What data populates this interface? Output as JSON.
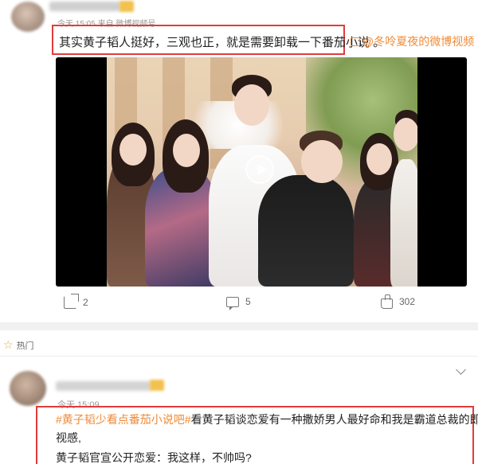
{
  "post": {
    "meta": "今天 15:05  来自 微博视频号",
    "text": "其实黄子韬人挺好，三观也正，就是需要卸载一下番茄小说 。",
    "video_link": "@冬呤夏夜的微博视频",
    "actions": {
      "share_count": "2",
      "comment_count": "5",
      "like_count": "302"
    }
  },
  "hot_section": {
    "label": "热门"
  },
  "comment": {
    "time": "今天 15:09",
    "hashtag": "#黄子韬少看点番茄小说吧#",
    "text_after_tag": "看黄子韬谈恋爱有一种撒娇男人最好命和我是霸道总裁的即",
    "text_line2": "视感,",
    "text_line3": "黄子韬官宣公开恋爱：我这样，不帅吗?"
  },
  "colors": {
    "highlight_border": "#e23b3b",
    "link_orange": "#ef8a38"
  }
}
